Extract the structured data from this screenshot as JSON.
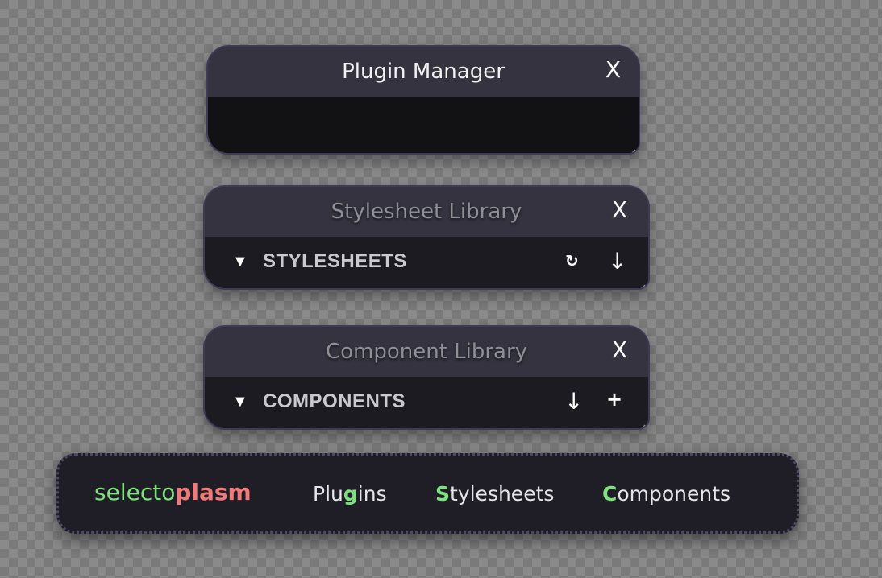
{
  "colors": {
    "accent_green": "#7ee07e",
    "accent_red": "#f07a7a",
    "panel_bg": "#1f1e26",
    "header_bg": "#34333f",
    "border": "#3e3a58"
  },
  "plugin_manager": {
    "title": "Plugin Manager",
    "close": "X"
  },
  "stylesheet_library": {
    "title": "Stylesheet Library",
    "close": "X",
    "section": {
      "caret": "▼",
      "label": "STYLESHEETS",
      "reload_icon": "↻",
      "download_icon": "↓"
    }
  },
  "component_library": {
    "title": "Component Library",
    "close": "X",
    "section": {
      "caret": "▼",
      "label": "COMPONENTS",
      "download_icon": "↓",
      "add_icon": "+"
    }
  },
  "menubar": {
    "logo_part1": "selecto",
    "logo_part2": "plasm",
    "plugins": {
      "before": "Plu",
      "highlight": "g",
      "after": "ins"
    },
    "stylesheets": {
      "highlight": "S",
      "after": "tylesheets"
    },
    "components": {
      "highlight": "C",
      "after": "omponents"
    }
  }
}
